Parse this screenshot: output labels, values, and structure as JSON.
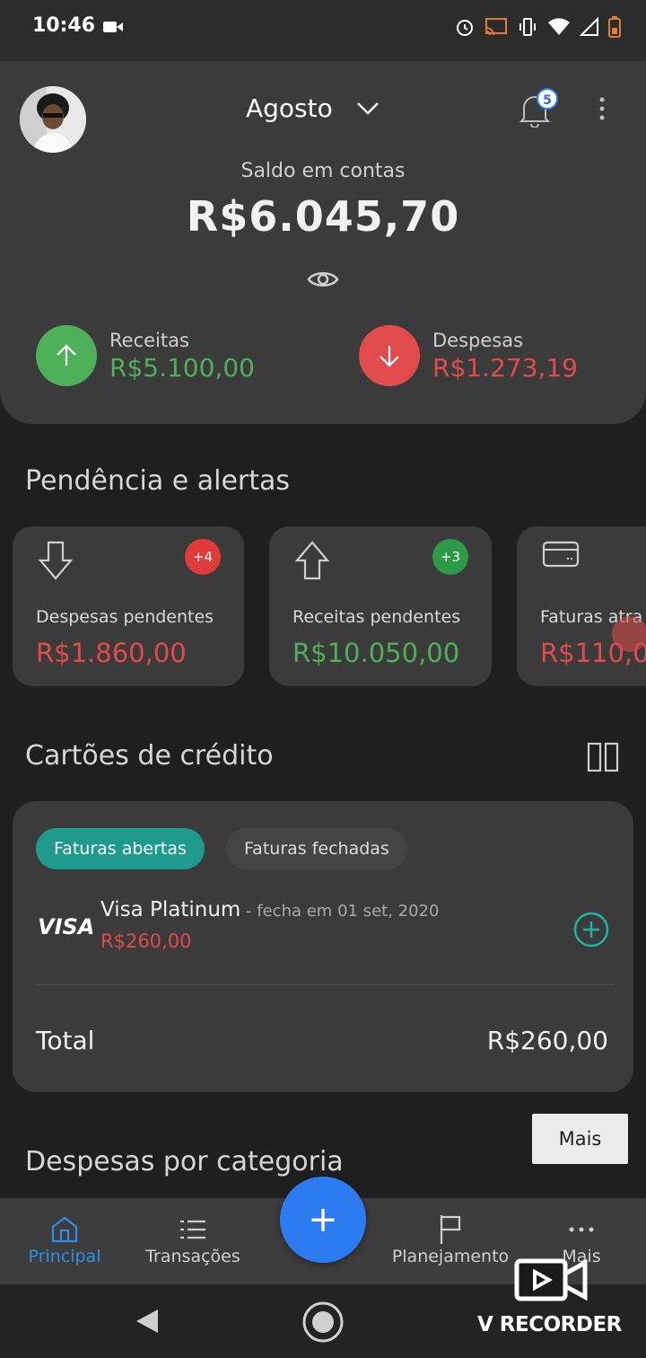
{
  "status_bar": {
    "time": "10:46"
  },
  "header": {
    "month": "Agosto",
    "notifications_count": "5",
    "balance_label": "Saldo em contas",
    "balance_value": "R$6.045,70",
    "income": {
      "label": "Receitas",
      "value": "R$5.100,00"
    },
    "expenses": {
      "label": "Despesas",
      "value": "R$1.273,19"
    }
  },
  "alerts": {
    "title": "Pendência e alertas",
    "cards": [
      {
        "label": "Despesas pendentes",
        "value": "R$1.860,00",
        "count": "+4",
        "color": "#e24b4b"
      },
      {
        "label": "Receitas pendentes",
        "value": "R$10.050,00",
        "count": "+3",
        "color": "#4fb05a"
      },
      {
        "label": "Faturas atra",
        "value": "R$110,0"
      }
    ]
  },
  "credit_cards": {
    "title": "Cartões de crédito",
    "tabs": [
      "Faturas abertas",
      "Faturas fechadas"
    ],
    "card": {
      "brand": "VISA",
      "name": "Visa Platinum",
      "closing": " - fecha em 01 set, 2020",
      "amount": "R$260,00"
    },
    "total_label": "Total",
    "total_value": "R$260,00"
  },
  "more_button": "Mais",
  "category_section_title": "Despesas por categoria",
  "bottom_nav": {
    "items": [
      {
        "label": "Principal"
      },
      {
        "label": "Transações"
      },
      {
        "label": "Planejamento"
      },
      {
        "label": "Mais"
      }
    ],
    "fab_label": "+"
  },
  "overlay": {
    "recorder_text": "V RECORDER"
  },
  "colors": {
    "accent": "#2c7cf0",
    "income": "#4fb05a",
    "expense": "#e24b4b",
    "teal": "#1f9b8e"
  }
}
